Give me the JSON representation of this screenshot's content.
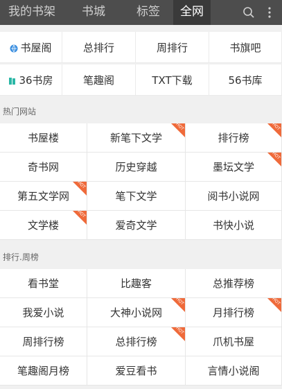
{
  "tabs": [
    {
      "label": "我的书架",
      "active": false
    },
    {
      "label": "书城",
      "active": false
    },
    {
      "label": "标签",
      "active": false
    },
    {
      "label": "全网",
      "active": true
    }
  ],
  "top_icons": {
    "search": "search-icon",
    "more": "more-vertical-icon"
  },
  "sources_row1": [
    "书屋阁",
    "总排行",
    "周排行",
    "书旗吧"
  ],
  "sources_row2": [
    "36书房",
    "笔趣阁",
    "TXT下载",
    "56书库"
  ],
  "hot_sites": {
    "title": "热门网站",
    "items": [
      {
        "label": "书屋楼",
        "hot": false
      },
      {
        "label": "新笔下文学",
        "hot": true
      },
      {
        "label": "排行榜",
        "hot": true
      },
      {
        "label": "奇书网",
        "hot": false
      },
      {
        "label": "历史穿越",
        "hot": false
      },
      {
        "label": "墨坛文学",
        "hot": true
      },
      {
        "label": "第五文学网",
        "hot": true
      },
      {
        "label": "笔下文学",
        "hot": false
      },
      {
        "label": "阅书小说网",
        "hot": false
      },
      {
        "label": "文学楼",
        "hot": true
      },
      {
        "label": "爱奇文学",
        "hot": false
      },
      {
        "label": "书快小说",
        "hot": false
      }
    ]
  },
  "rank": {
    "title": "排行.周榜",
    "items": [
      {
        "label": "看书堂",
        "hot": false
      },
      {
        "label": "比趣客",
        "hot": false
      },
      {
        "label": "总推荐榜",
        "hot": false
      },
      {
        "label": "我爱小说",
        "hot": false
      },
      {
        "label": "大神小说网",
        "hot": true
      },
      {
        "label": "月排行榜",
        "hot": true
      },
      {
        "label": "周排行榜",
        "hot": false
      },
      {
        "label": "总排行榜",
        "hot": true
      },
      {
        "label": "爪机书屋",
        "hot": false
      },
      {
        "label": "笔趣阁月榜",
        "hot": false
      },
      {
        "label": "爱豆看书",
        "hot": false
      },
      {
        "label": "言情小说阁",
        "hot": false
      }
    ]
  },
  "hot_badge": "HOT",
  "colors": {
    "topbar": "#4d4d4d",
    "active_tab": "#3a3a3a",
    "hot": "#ef6a3a",
    "source_icon_1": "#3b8fe0",
    "source_icon_2": "#2bb7a6"
  }
}
